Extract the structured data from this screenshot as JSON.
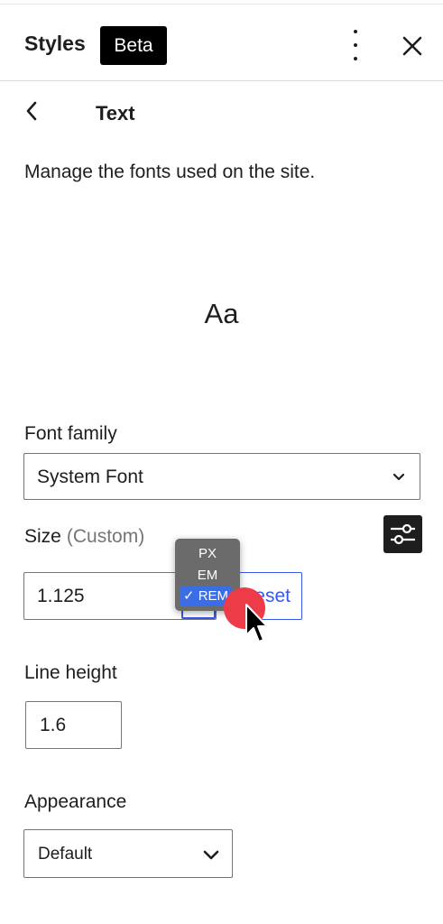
{
  "header": {
    "title": "Styles",
    "badge": "Beta"
  },
  "panel": {
    "title": "Text",
    "description": "Manage the fonts used on the site.",
    "preview": "Aa"
  },
  "font_family": {
    "label": "Font family",
    "value": "System Font"
  },
  "size": {
    "label": "Size",
    "note": "(Custom)",
    "value": "1.125",
    "reset_label": "Reset",
    "units": [
      {
        "label": "PX",
        "selected": false
      },
      {
        "label": "EM",
        "selected": false
      },
      {
        "label": "✓ REM",
        "selected": true
      }
    ]
  },
  "line_height": {
    "label": "Line height",
    "value": "1.6"
  },
  "appearance": {
    "label": "Appearance",
    "value": "Default"
  },
  "icons": [
    "kebab-menu-icon",
    "close-icon",
    "back-chevron-icon",
    "chevron-down-icon",
    "sliders-icon",
    "mouse-cursor-icon"
  ],
  "colors": {
    "accent": "#3858e9",
    "click_marker": "#ee3b48",
    "badge_bg": "#000000"
  }
}
